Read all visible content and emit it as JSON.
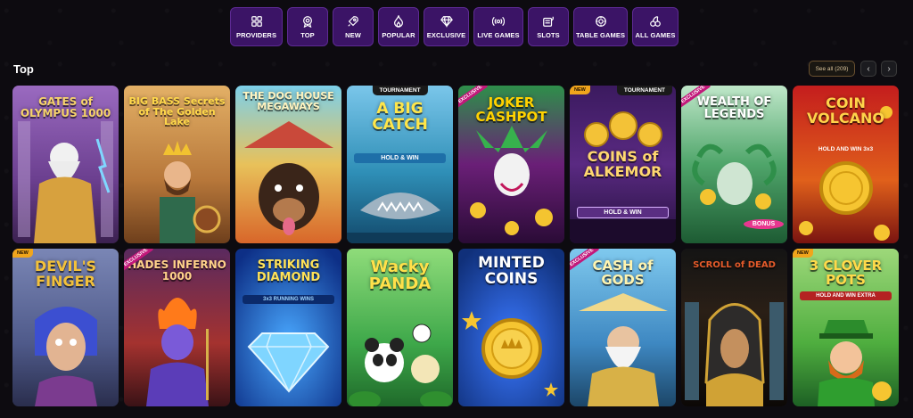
{
  "categories": [
    {
      "label": "PROVIDERS",
      "icon": "grid-icon",
      "width": 59
    },
    {
      "label": "TOP",
      "icon": "medal-icon",
      "width": 46
    },
    {
      "label": "NEW",
      "icon": "rocket-icon",
      "width": 46
    },
    {
      "label": "POPULAR",
      "icon": "flame-icon",
      "width": 46
    },
    {
      "label": "EXCLUSIVE",
      "icon": "diamond-icon",
      "width": 51
    },
    {
      "label": "LIVE GAMES",
      "icon": "broadcast-icon",
      "width": 56
    },
    {
      "label": "SLOTS",
      "icon": "slot-machine-icon",
      "width": 46
    },
    {
      "label": "TABLE GAMES",
      "icon": "chip-icon",
      "width": 61
    },
    {
      "label": "ALL GAMES",
      "icon": "cherries-icon",
      "width": 52
    }
  ],
  "section": {
    "title": "Top",
    "see_all": "See all (209)"
  },
  "games": [
    {
      "title": "GATES of OLYMPUS 1000",
      "badge": "",
      "tag": ""
    },
    {
      "title": "BIG BASS Secrets of The Golden Lake",
      "badge": "",
      "tag": ""
    },
    {
      "title": "THE DOG HOUSE MEGAWAYS",
      "badge": "",
      "tag": ""
    },
    {
      "title": "A BIG CATCH",
      "sub": "HOLD & WIN",
      "badge": "",
      "tag": "TOURNAMENT"
    },
    {
      "title": "JOKER CASHPOT",
      "badge": "EXCLUSIVE",
      "tag": ""
    },
    {
      "title": "COINS of ALKEMOR",
      "sub": "HOLD & WIN",
      "badge": "NEW",
      "tag": "TOURNAMENT"
    },
    {
      "title": "WEALTH OF LEGENDS",
      "sub": "BONUS",
      "badge": "EXCLUSIVE",
      "tag": ""
    },
    {
      "title": "COIN VOLCANO",
      "sub": "HOLD AND WIN 3x3",
      "badge": "",
      "tag": ""
    },
    {
      "title": "DEVIL'S FINGER",
      "badge": "NEW",
      "tag": ""
    },
    {
      "title": "HADES INFERNO 1000",
      "badge": "EXCLUSIVE",
      "tag": ""
    },
    {
      "title": "STRIKING DIAMOND",
      "sub": "3x3 RUNNING WINS",
      "badge": "",
      "tag": ""
    },
    {
      "title": "Wacky PANDA",
      "badge": "",
      "tag": ""
    },
    {
      "title": "MINTED COINS",
      "badge": "",
      "tag": ""
    },
    {
      "title": "CASH of GODS",
      "badge": "EXCLUSIVE",
      "tag": ""
    },
    {
      "title": "SCROLL of DEAD",
      "badge": "",
      "tag": ""
    },
    {
      "title": "3 CLOVER POTS",
      "sub": "HOLD AND WIN EXTRA",
      "badge": "NEW",
      "tag": ""
    }
  ],
  "colors": {
    "accent": "#3b1466",
    "border": "#5d2a93",
    "background": "#0d0b10"
  }
}
